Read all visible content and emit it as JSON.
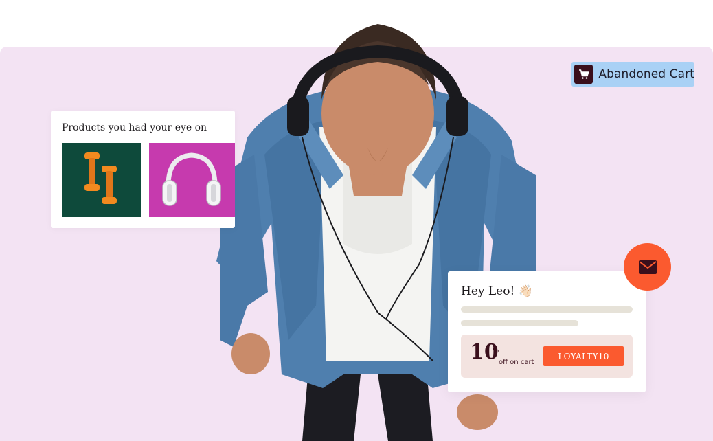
{
  "tag": {
    "label": "Abandoned Cart",
    "icon": "shopping-cart-icon",
    "bg_color": "#a9d1f5",
    "icon_bg_color": "#3a0f1c"
  },
  "products": {
    "title": "Products you had your eye on",
    "items": [
      {
        "name": "dumbbells",
        "bg_color": "#0e4a3b",
        "accent": "#f28a1f"
      },
      {
        "name": "headphones",
        "bg_color": "#c63aae",
        "accent": "#e8e8ea"
      }
    ]
  },
  "email": {
    "greeting": "Hey Leo! 👋🏻",
    "offer": {
      "amount": "10",
      "percent": "%",
      "subtitle": "off on cart"
    },
    "coupon_code": "LOYALTY10",
    "accent_color": "#fb5a2f",
    "mail_icon": "envelope-icon"
  },
  "colors": {
    "panel_bg": "#f3e3f3",
    "dark": "#3a0f1c",
    "orange": "#fb5a2f"
  }
}
